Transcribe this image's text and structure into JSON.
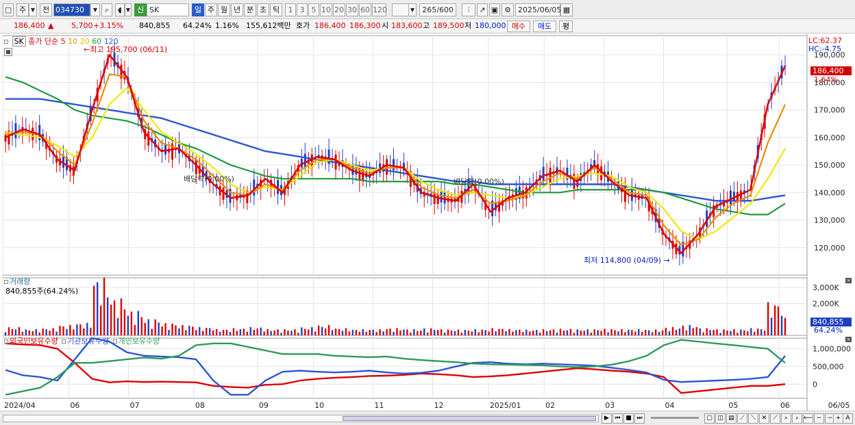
{
  "toolbar": {
    "period_label": "주",
    "prev_label": "전",
    "code": "034730",
    "credit_badge": "신",
    "stock_name": "SK",
    "tabs": [
      "일",
      "주",
      "월",
      "년",
      "분",
      "초",
      "틱"
    ],
    "intervals": [
      "1",
      "3",
      "5",
      "10",
      "20",
      "30",
      "60",
      "120"
    ],
    "count_display": "265/600",
    "date": "2025/06/05"
  },
  "quote": {
    "price": "186,400",
    "change": "5,700",
    "change_pct": "+3.15%",
    "volume": "840,855",
    "vol_ratio": "64.24%",
    "turnover": "1.16%",
    "amount": "155,612백만",
    "bid_label": "호가",
    "ask": "186,400",
    "bid": "186,300",
    "open_label": "시",
    "open": "183,600",
    "high_label": "고",
    "high": "189,500",
    "low_label": "저",
    "low": "180,000",
    "buy_label": "매수",
    "sell_label": "매도",
    "eval_label": "평"
  },
  "price_panel": {
    "symbol": "SK",
    "ma_label": "종가 단순",
    "ma_periods": [
      "5",
      "10",
      "20",
      "60",
      "120"
    ],
    "high_annotation": "최고 195,700 (06/11)",
    "low_annotation": "최저 114,800 (04/09)",
    "dividend_labels": [
      "배당락(0.00%)",
      "배당락(0.00%)"
    ],
    "lc": "LC:62.37",
    "hc": "HC:-4.75",
    "current_tag": "186,400",
    "current_pct": "1.64%"
  },
  "volume_panel": {
    "title": "거래량",
    "value_text": "840,855주(64.24%)",
    "tag_value": "840,855",
    "tag_pct": "64.24%"
  },
  "holding_panel": {
    "legend": [
      "외국인보유수량",
      "기관보유수량",
      "개인보유수량"
    ]
  },
  "colors": {
    "up": "#e00000",
    "down": "#1f3fc0",
    "ma5": "#e00000",
    "ma10": "#f08c00",
    "ma20": "#f2e60a",
    "ma60": "#1e9a3c",
    "ma120": "#2c55d6",
    "foreign": "#e00000",
    "inst": "#2c55d6",
    "indiv": "#2e9a5c",
    "grid": "#e3e3e3"
  },
  "chart_data": [
    {
      "type": "line",
      "title": "SK",
      "x_ticks": [
        "2024/04",
        "06",
        "07",
        "08",
        "09",
        "10",
        "11",
        "12",
        "2025/01",
        "02",
        "03",
        "04",
        "05",
        "06",
        "06/05"
      ],
      "ylim": [
        110000,
        197000
      ],
      "y_ticks": [
        "190,000",
        "180,000",
        "170,000",
        "160,000",
        "150,000",
        "140,000",
        "130,000",
        "120,000"
      ],
      "series": [
        {
          "name": "5",
          "values": [
            160000,
            163000,
            161000,
            152000,
            148000,
            170000,
            190000,
            182000,
            162000,
            155000,
            156000,
            150000,
            143000,
            138000,
            139000,
            145000,
            140000,
            150000,
            153000,
            152000,
            148000,
            146000,
            150000,
            149000,
            140000,
            138000,
            137000,
            143000,
            133000,
            138000,
            140000,
            146000,
            148000,
            144000,
            150000,
            144000,
            139000,
            138000,
            125000,
            118000,
            125000,
            135000,
            138000,
            141000,
            172000,
            186000
          ]
        },
        {
          "name": "10",
          "values": [
            161000,
            162000,
            161000,
            155000,
            150000,
            165000,
            183000,
            182000,
            166000,
            158000,
            156000,
            152000,
            146000,
            140000,
            139000,
            143000,
            141000,
            148000,
            152000,
            152000,
            149000,
            147000,
            149000,
            149000,
            142000,
            139000,
            138000,
            141000,
            136000,
            137000,
            139000,
            144000,
            147000,
            145000,
            149000,
            145000,
            140000,
            139000,
            128000,
            121000,
            123000,
            131000,
            136000,
            139000,
            158000,
            172000
          ]
        },
        {
          "name": "20",
          "values": [
            162000,
            161000,
            160000,
            157000,
            153000,
            160000,
            172000,
            178000,
            170000,
            162000,
            158000,
            154000,
            149000,
            143000,
            140000,
            142000,
            141000,
            146000,
            151000,
            152000,
            150000,
            148000,
            149000,
            149000,
            144000,
            141000,
            139000,
            140000,
            139000,
            138000,
            139000,
            142000,
            145000,
            146000,
            147000,
            146000,
            142000,
            140000,
            134000,
            126000,
            123000,
            126000,
            131000,
            136000,
            145000,
            156000
          ]
        },
        {
          "name": "60",
          "values": [
            182000,
            180000,
            177000,
            174000,
            170000,
            168000,
            167000,
            166000,
            164000,
            161000,
            158000,
            156000,
            153000,
            150000,
            148000,
            146000,
            145000,
            145000,
            145000,
            145000,
            145000,
            144000,
            144000,
            144000,
            144000,
            144000,
            143000,
            143000,
            142000,
            141000,
            140000,
            140000,
            140000,
            141000,
            141000,
            141000,
            141000,
            141000,
            140000,
            138000,
            136000,
            134000,
            133000,
            132000,
            132000,
            136000
          ]
        },
        {
          "name": "120",
          "values": [
            174000,
            174000,
            174000,
            173000,
            172000,
            171000,
            170000,
            169000,
            168000,
            167000,
            165000,
            163000,
            161000,
            159000,
            157000,
            155000,
            154000,
            153000,
            152000,
            151000,
            150000,
            149000,
            148000,
            147000,
            146000,
            145000,
            144000,
            144000,
            143000,
            143000,
            143000,
            143000,
            143000,
            143000,
            143000,
            143000,
            142000,
            141000,
            140000,
            139000,
            138000,
            137000,
            137000,
            137000,
            138000,
            139000
          ]
        }
      ]
    },
    {
      "type": "bar",
      "title": "거래량",
      "y_ticks": [
        "3,000K",
        "2,000K"
      ],
      "ylim": [
        0,
        3600000
      ],
      "values": [
        400,
        300,
        350,
        500,
        600,
        2800,
        1800,
        1200,
        800,
        600,
        500,
        400,
        300,
        350,
        400,
        300,
        300,
        400,
        500,
        350,
        300,
        300,
        350,
        300,
        350,
        300,
        280,
        300,
        350,
        300,
        280,
        300,
        320,
        300,
        320,
        300,
        300,
        280,
        400,
        500,
        350,
        300,
        300,
        350,
        1600,
        840
      ]
    },
    {
      "type": "line",
      "title": "보유수량",
      "y_ticks": [
        "1,000,000",
        "500,000",
        "0"
      ],
      "ylim": [
        -400000,
        1300000
      ],
      "series": [
        {
          "name": "외국인보유수량",
          "values": [
            1150000,
            1120000,
            1100000,
            1000000,
            600000,
            150000,
            50000,
            80000,
            60000,
            70000,
            60000,
            50000,
            -50000,
            -80000,
            -100000,
            -20000,
            0,
            100000,
            150000,
            180000,
            200000,
            230000,
            240000,
            260000,
            300000,
            280000,
            250000,
            200000,
            220000,
            250000,
            300000,
            350000,
            400000,
            450000,
            420000,
            380000,
            350000,
            300000,
            200000,
            -250000,
            -200000,
            -150000,
            -100000,
            -50000,
            -50000,
            0
          ]
        },
        {
          "name": "기관보유수량",
          "values": [
            400000,
            250000,
            200000,
            100000,
            700000,
            1300000,
            1200000,
            900000,
            800000,
            780000,
            760000,
            700000,
            100000,
            -300000,
            -300000,
            100000,
            350000,
            380000,
            350000,
            330000,
            350000,
            380000,
            330000,
            300000,
            320000,
            380000,
            500000,
            600000,
            620000,
            580000,
            560000,
            580000,
            560000,
            540000,
            520000,
            460000,
            400000,
            330000,
            120000,
            60000,
            80000,
            100000,
            120000,
            150000,
            200000,
            800000
          ]
        },
        {
          "name": "개인보유수량",
          "values": [
            -300000,
            -200000,
            -100000,
            200000,
            600000,
            600000,
            650000,
            700000,
            750000,
            720000,
            800000,
            1100000,
            1150000,
            1150000,
            1050000,
            950000,
            850000,
            850000,
            850000,
            800000,
            780000,
            760000,
            780000,
            720000,
            680000,
            650000,
            620000,
            580000,
            560000,
            550000,
            540000,
            530000,
            500000,
            480000,
            500000,
            550000,
            650000,
            800000,
            1100000,
            1250000,
            1200000,
            1150000,
            1100000,
            1050000,
            1000000,
            600000
          ]
        }
      ]
    }
  ]
}
